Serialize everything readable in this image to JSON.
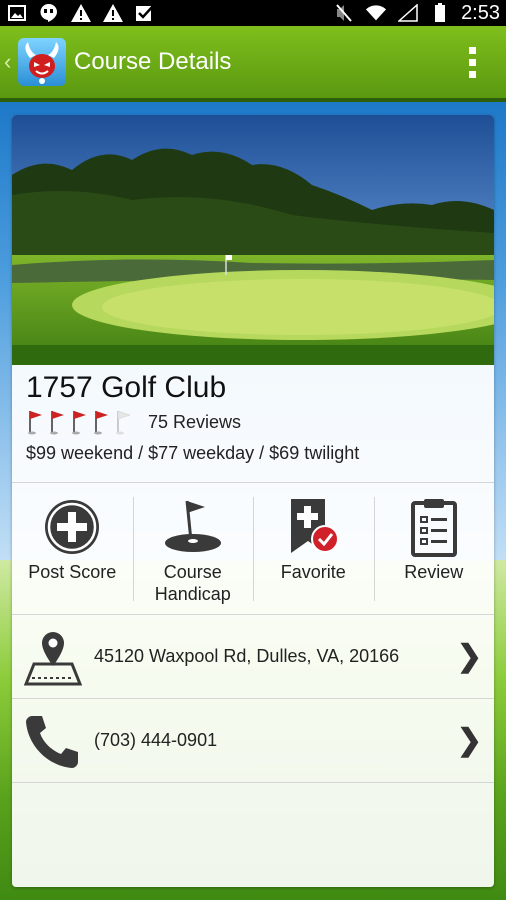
{
  "status_bar": {
    "time": "2:53",
    "left_icons": [
      "image-icon",
      "hangouts-icon",
      "warning-icon",
      "warning-icon",
      "checkbox-icon"
    ],
    "right_icons": [
      "mute-icon",
      "wifi-icon",
      "signal-icon",
      "battery-icon"
    ]
  },
  "action_bar": {
    "title": "Course Details",
    "back_icon": "chevron-left-icon",
    "app_icon": "golf-devil-logo-icon",
    "overflow_icon": "more-vert-icon",
    "color": "#6aab16"
  },
  "course": {
    "name": "1757 Golf Club",
    "rating": 4,
    "rating_max": 5,
    "reviews": "75 Reviews",
    "price": "$99 weekend / $77 weekday / $69 twilight"
  },
  "actions": [
    {
      "label": "Post Score",
      "icon": "plus-circle-icon"
    },
    {
      "label": "Course Handicap",
      "icon": "golf-green-flag-icon"
    },
    {
      "label": "Favorite",
      "icon": "bookmark-check-icon"
    },
    {
      "label": "Review",
      "icon": "clipboard-list-icon"
    }
  ],
  "address": {
    "text": "45120 Waxpool Rd, Dulles, VA, 20166",
    "icon": "map-pin-icon"
  },
  "phone": {
    "text": "(703) 444-0901",
    "icon": "phone-icon"
  },
  "colors": {
    "flag_red": "#cc2222",
    "accent_red": "#d0202a"
  }
}
